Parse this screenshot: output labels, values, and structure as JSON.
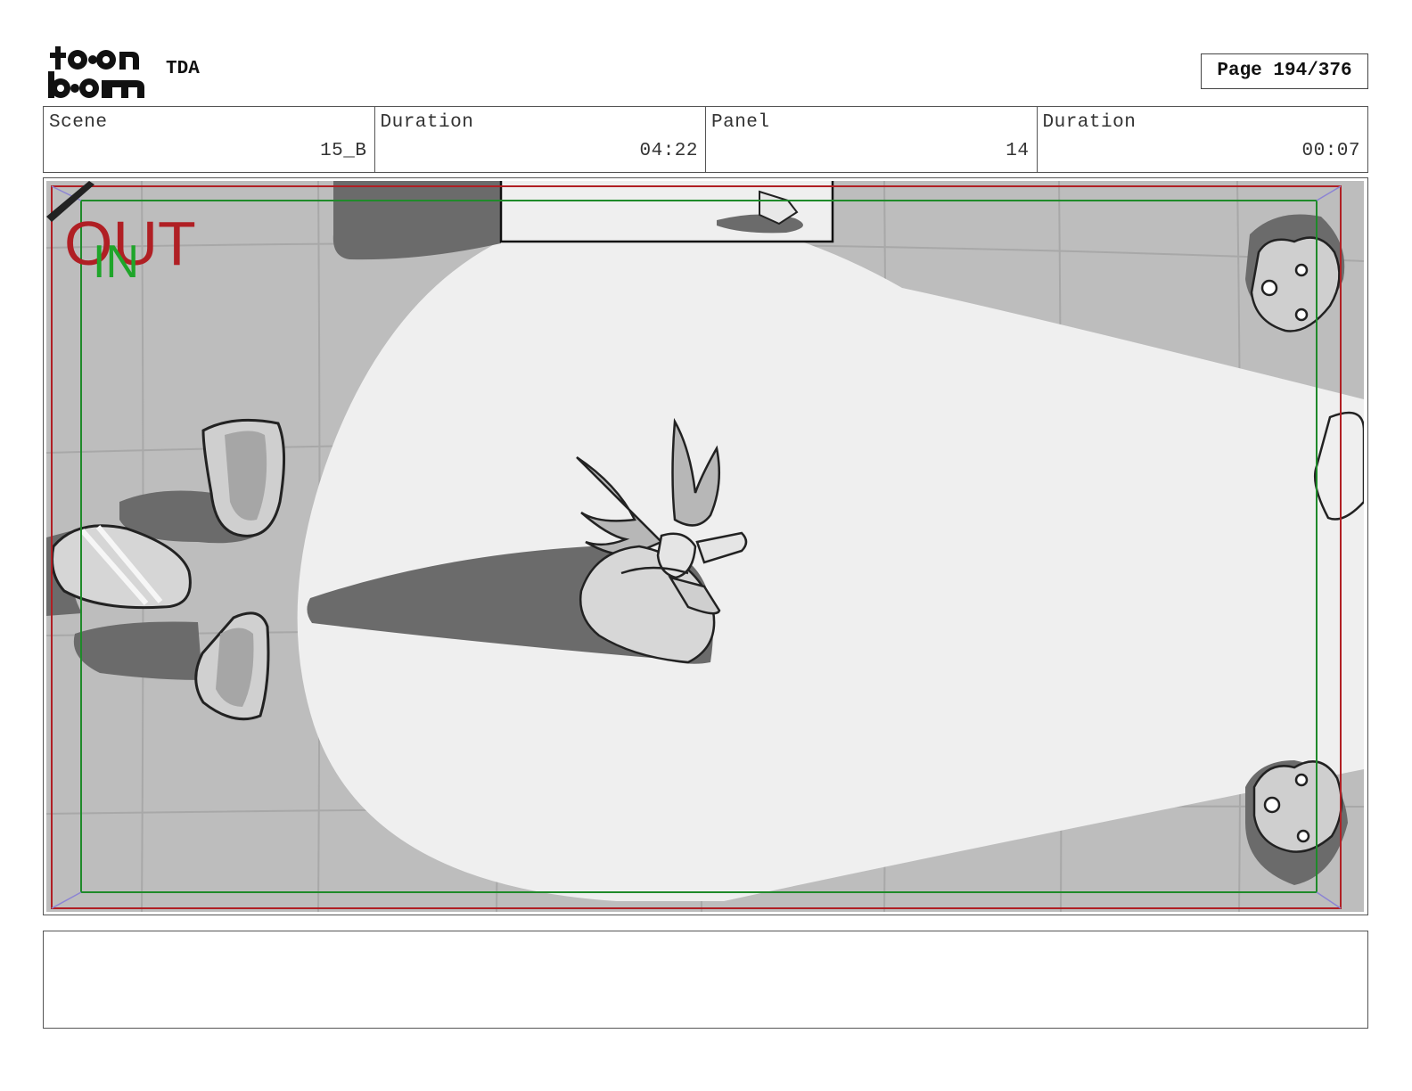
{
  "header": {
    "project": "TDA",
    "page_label": "Page 194/376"
  },
  "info": {
    "scene_label": "Scene",
    "scene_value": "15_B",
    "scene_duration_label": "Duration",
    "scene_duration_value": "04:22",
    "panel_label": "Panel",
    "panel_value": "14",
    "panel_duration_label": "Duration",
    "panel_duration_value": "00:07"
  },
  "panel": {
    "out_label": "OUT",
    "in_label": "IN"
  },
  "notes": {
    "text": ""
  },
  "colors": {
    "out_frame": "#b01f24",
    "in_frame": "#1f8a2a",
    "floor": "#bdbdbd",
    "spotlight": "#efefef",
    "shadow": "#6b6b6b"
  }
}
